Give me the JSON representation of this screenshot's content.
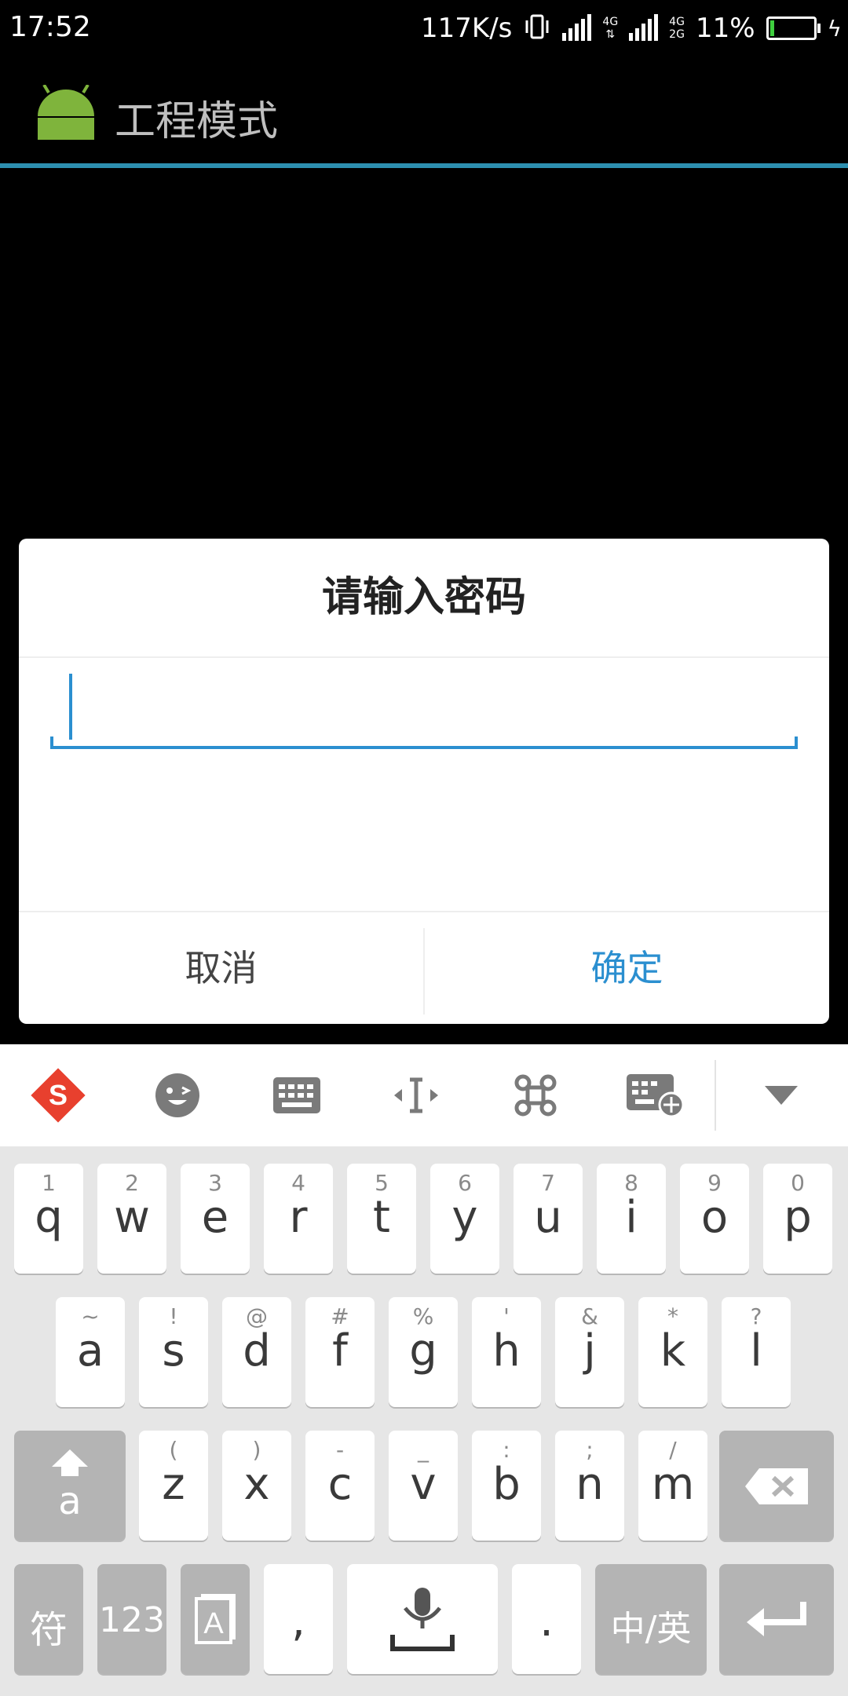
{
  "status": {
    "time": "17:52",
    "speed": "117K/s",
    "net1": "4G",
    "net2_top": "4G",
    "net2_bottom": "2G",
    "battery_pct": "11%",
    "battery_level": 0.11
  },
  "app": {
    "title": "工程模式"
  },
  "dialog": {
    "title": "请输入密码",
    "password_value": "",
    "cancel": "取消",
    "ok": "确定"
  },
  "keyboard": {
    "toolbar": [
      "sogou-logo-icon",
      "emoji-icon",
      "keyboard-icon",
      "cursor-move-icon",
      "command-icon",
      "keyboard-settings-icon",
      "collapse-icon"
    ],
    "row1": [
      {
        "hint": "1",
        "key": "q"
      },
      {
        "hint": "2",
        "key": "w"
      },
      {
        "hint": "3",
        "key": "e"
      },
      {
        "hint": "4",
        "key": "r"
      },
      {
        "hint": "5",
        "key": "t"
      },
      {
        "hint": "6",
        "key": "y"
      },
      {
        "hint": "7",
        "key": "u"
      },
      {
        "hint": "8",
        "key": "i"
      },
      {
        "hint": "9",
        "key": "o"
      },
      {
        "hint": "0",
        "key": "p"
      }
    ],
    "row2": [
      {
        "hint": "~",
        "key": "a"
      },
      {
        "hint": "!",
        "key": "s"
      },
      {
        "hint": "@",
        "key": "d"
      },
      {
        "hint": "#",
        "key": "f"
      },
      {
        "hint": "%",
        "key": "g"
      },
      {
        "hint": "'",
        "key": "h"
      },
      {
        "hint": "&",
        "key": "j"
      },
      {
        "hint": "*",
        "key": "k"
      },
      {
        "hint": "?",
        "key": "l"
      }
    ],
    "row3": [
      {
        "hint": "(",
        "key": "z"
      },
      {
        "hint": ")",
        "key": "x"
      },
      {
        "hint": "-",
        "key": "c"
      },
      {
        "hint": "_",
        "key": "v"
      },
      {
        "hint": ":",
        "key": "b"
      },
      {
        "hint": ";",
        "key": "n"
      },
      {
        "hint": "/",
        "key": "m"
      }
    ],
    "shift_letter": "a",
    "symbols": "符",
    "numbers": "123",
    "comma": ",",
    "period": ".",
    "lang": "中/英"
  },
  "colors": {
    "accent": "#2b8fd0",
    "divider": "#2d8fb0"
  }
}
